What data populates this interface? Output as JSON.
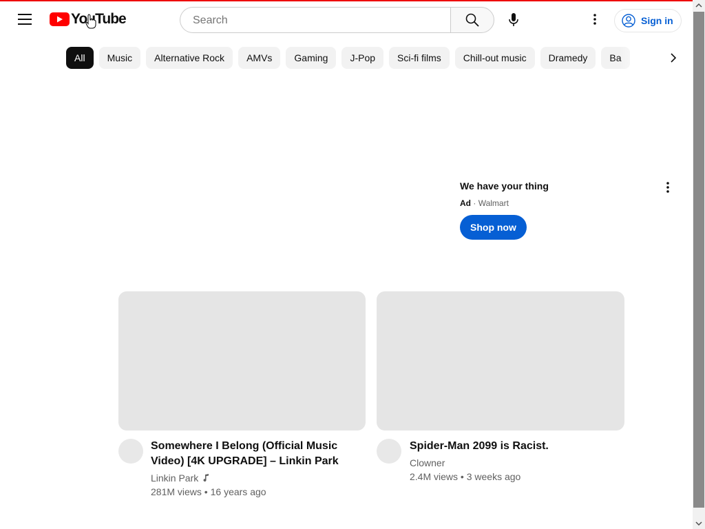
{
  "header": {
    "logo_text": "YouTube",
    "search_placeholder": "Search",
    "signin_label": "Sign in"
  },
  "chips": [
    "All",
    "Music",
    "Alternative Rock",
    "AMVs",
    "Gaming",
    "J-Pop",
    "Sci-fi films",
    "Chill-out music",
    "Dramedy",
    "Ba"
  ],
  "ad": {
    "title": "We have your thing",
    "badge": "Ad",
    "separator": "·",
    "advertiser": "Walmart",
    "cta": "Shop now"
  },
  "videos": [
    {
      "title": "Somewhere I Belong (Official Music Video) [4K UPGRADE] – Linkin Park",
      "channel": "Linkin Park",
      "views": "281M views",
      "age": "16 years ago"
    },
    {
      "title": "Spider-Man 2099 is Racist.",
      "channel": "Clowner",
      "views": "2.4M views",
      "age": "3 weeks ago"
    }
  ],
  "colors": {
    "brand_red": "#ff0000",
    "link_blue": "#065fd4",
    "chip_bg": "#f2f2f2",
    "placeholder_gray": "#e5e5e5"
  },
  "icons": [
    "menu-icon",
    "youtube-logo-icon",
    "search-icon",
    "mic-icon",
    "more-vert-icon",
    "account-icon",
    "chevron-right-icon",
    "music-note-icon"
  ]
}
